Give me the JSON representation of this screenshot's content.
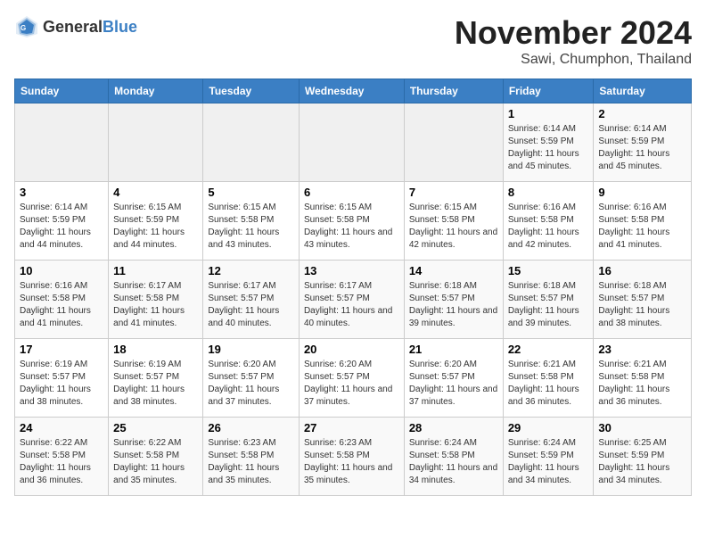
{
  "logo": {
    "text_general": "General",
    "text_blue": "Blue"
  },
  "title": "November 2024",
  "subtitle": "Sawi, Chumphon, Thailand",
  "weekdays": [
    "Sunday",
    "Monday",
    "Tuesday",
    "Wednesday",
    "Thursday",
    "Friday",
    "Saturday"
  ],
  "weeks": [
    [
      {
        "day": "",
        "info": ""
      },
      {
        "day": "",
        "info": ""
      },
      {
        "day": "",
        "info": ""
      },
      {
        "day": "",
        "info": ""
      },
      {
        "day": "",
        "info": ""
      },
      {
        "day": "1",
        "info": "Sunrise: 6:14 AM\nSunset: 5:59 PM\nDaylight: 11 hours and 45 minutes."
      },
      {
        "day": "2",
        "info": "Sunrise: 6:14 AM\nSunset: 5:59 PM\nDaylight: 11 hours and 45 minutes."
      }
    ],
    [
      {
        "day": "3",
        "info": "Sunrise: 6:14 AM\nSunset: 5:59 PM\nDaylight: 11 hours and 44 minutes."
      },
      {
        "day": "4",
        "info": "Sunrise: 6:15 AM\nSunset: 5:59 PM\nDaylight: 11 hours and 44 minutes."
      },
      {
        "day": "5",
        "info": "Sunrise: 6:15 AM\nSunset: 5:58 PM\nDaylight: 11 hours and 43 minutes."
      },
      {
        "day": "6",
        "info": "Sunrise: 6:15 AM\nSunset: 5:58 PM\nDaylight: 11 hours and 43 minutes."
      },
      {
        "day": "7",
        "info": "Sunrise: 6:15 AM\nSunset: 5:58 PM\nDaylight: 11 hours and 42 minutes."
      },
      {
        "day": "8",
        "info": "Sunrise: 6:16 AM\nSunset: 5:58 PM\nDaylight: 11 hours and 42 minutes."
      },
      {
        "day": "9",
        "info": "Sunrise: 6:16 AM\nSunset: 5:58 PM\nDaylight: 11 hours and 41 minutes."
      }
    ],
    [
      {
        "day": "10",
        "info": "Sunrise: 6:16 AM\nSunset: 5:58 PM\nDaylight: 11 hours and 41 minutes."
      },
      {
        "day": "11",
        "info": "Sunrise: 6:17 AM\nSunset: 5:58 PM\nDaylight: 11 hours and 41 minutes."
      },
      {
        "day": "12",
        "info": "Sunrise: 6:17 AM\nSunset: 5:57 PM\nDaylight: 11 hours and 40 minutes."
      },
      {
        "day": "13",
        "info": "Sunrise: 6:17 AM\nSunset: 5:57 PM\nDaylight: 11 hours and 40 minutes."
      },
      {
        "day": "14",
        "info": "Sunrise: 6:18 AM\nSunset: 5:57 PM\nDaylight: 11 hours and 39 minutes."
      },
      {
        "day": "15",
        "info": "Sunrise: 6:18 AM\nSunset: 5:57 PM\nDaylight: 11 hours and 39 minutes."
      },
      {
        "day": "16",
        "info": "Sunrise: 6:18 AM\nSunset: 5:57 PM\nDaylight: 11 hours and 38 minutes."
      }
    ],
    [
      {
        "day": "17",
        "info": "Sunrise: 6:19 AM\nSunset: 5:57 PM\nDaylight: 11 hours and 38 minutes."
      },
      {
        "day": "18",
        "info": "Sunrise: 6:19 AM\nSunset: 5:57 PM\nDaylight: 11 hours and 38 minutes."
      },
      {
        "day": "19",
        "info": "Sunrise: 6:20 AM\nSunset: 5:57 PM\nDaylight: 11 hours and 37 minutes."
      },
      {
        "day": "20",
        "info": "Sunrise: 6:20 AM\nSunset: 5:57 PM\nDaylight: 11 hours and 37 minutes."
      },
      {
        "day": "21",
        "info": "Sunrise: 6:20 AM\nSunset: 5:57 PM\nDaylight: 11 hours and 37 minutes."
      },
      {
        "day": "22",
        "info": "Sunrise: 6:21 AM\nSunset: 5:58 PM\nDaylight: 11 hours and 36 minutes."
      },
      {
        "day": "23",
        "info": "Sunrise: 6:21 AM\nSunset: 5:58 PM\nDaylight: 11 hours and 36 minutes."
      }
    ],
    [
      {
        "day": "24",
        "info": "Sunrise: 6:22 AM\nSunset: 5:58 PM\nDaylight: 11 hours and 36 minutes."
      },
      {
        "day": "25",
        "info": "Sunrise: 6:22 AM\nSunset: 5:58 PM\nDaylight: 11 hours and 35 minutes."
      },
      {
        "day": "26",
        "info": "Sunrise: 6:23 AM\nSunset: 5:58 PM\nDaylight: 11 hours and 35 minutes."
      },
      {
        "day": "27",
        "info": "Sunrise: 6:23 AM\nSunset: 5:58 PM\nDaylight: 11 hours and 35 minutes."
      },
      {
        "day": "28",
        "info": "Sunrise: 6:24 AM\nSunset: 5:58 PM\nDaylight: 11 hours and 34 minutes."
      },
      {
        "day": "29",
        "info": "Sunrise: 6:24 AM\nSunset: 5:59 PM\nDaylight: 11 hours and 34 minutes."
      },
      {
        "day": "30",
        "info": "Sunrise: 6:25 AM\nSunset: 5:59 PM\nDaylight: 11 hours and 34 minutes."
      }
    ]
  ]
}
